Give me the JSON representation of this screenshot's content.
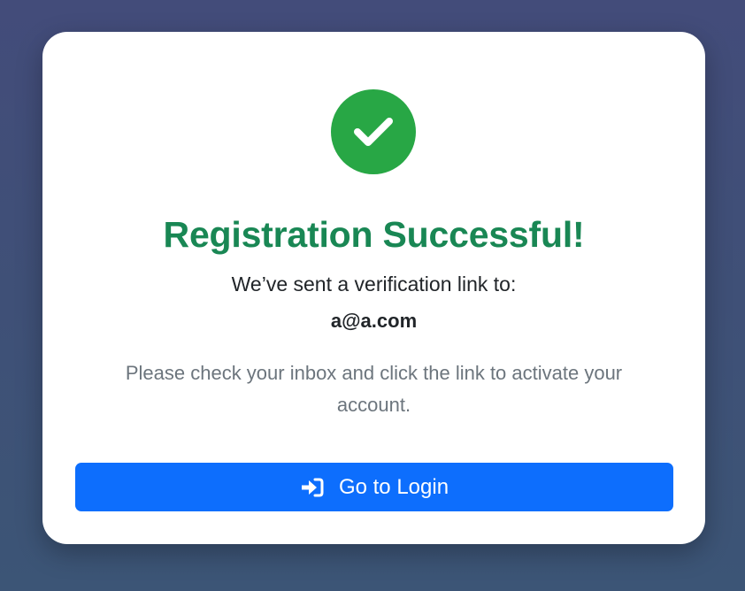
{
  "card": {
    "status_icon": "check-icon",
    "title": "Registration Successful!",
    "sent_text": "We’ve sent a verification link to:",
    "email": "a@a.com",
    "instructions": "Please check your inbox and click the link to activate your account."
  },
  "login_button": {
    "icon": "sign-in-icon",
    "label": "Go to Login"
  },
  "colors": {
    "success": "#28a745",
    "title": "#198754",
    "primary": "#0d6efd",
    "muted_text": "#6c757d"
  }
}
